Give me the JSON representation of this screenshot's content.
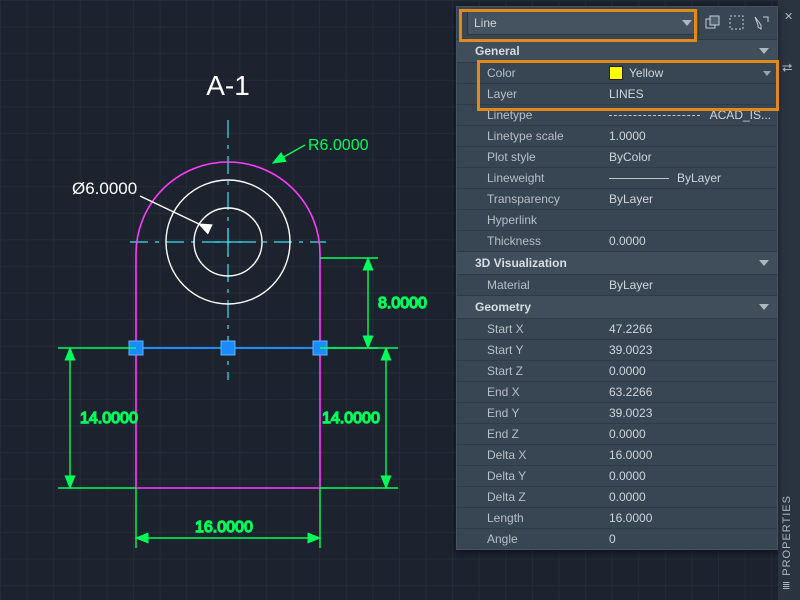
{
  "drawing": {
    "title": "A-1",
    "dims": {
      "radius": "R6.0000",
      "diameter": "Ø6.0000",
      "v_right_short": "8.0000",
      "v_left": "14.0000",
      "v_right": "14.0000",
      "h_bottom": "16.0000"
    }
  },
  "panel": {
    "object_type": "Line",
    "gutter_title": "PROPERTIES",
    "sections": {
      "general": "General",
      "visual": "3D Visualization",
      "geometry": "Geometry"
    },
    "general": {
      "color_label": "Color",
      "color_value": "Yellow",
      "color_hex": "#ffff00",
      "layer_label": "Layer",
      "layer_value": "LINES",
      "linetype_label": "Linetype",
      "linetype_value": "ACAD_IS...",
      "ltscale_label": "Linetype scale",
      "ltscale_value": "1.0000",
      "plot_label": "Plot style",
      "plot_value": "ByColor",
      "lw_label": "Lineweight",
      "lw_value": "ByLayer",
      "trans_label": "Transparency",
      "trans_value": "ByLayer",
      "link_label": "Hyperlink",
      "link_value": "",
      "thick_label": "Thickness",
      "thick_value": "0.0000"
    },
    "visual": {
      "mat_label": "Material",
      "mat_value": "ByLayer"
    },
    "geometry": {
      "sx_label": "Start X",
      "sx": "47.2266",
      "sy_label": "Start Y",
      "sy": "39.0023",
      "sz_label": "Start Z",
      "sz": "0.0000",
      "ex_label": "End X",
      "ex": "63.2266",
      "ey_label": "End Y",
      "ey": "39.0023",
      "ez_label": "End Z",
      "ez": "0.0000",
      "dx_label": "Delta X",
      "dx": "16.0000",
      "dy_label": "Delta Y",
      "dy": "0.0000",
      "dz_label": "Delta Z",
      "dz": "0.0000",
      "len_label": "Length",
      "len": "16.0000",
      "ang_label": "Angle",
      "ang": "0"
    }
  }
}
